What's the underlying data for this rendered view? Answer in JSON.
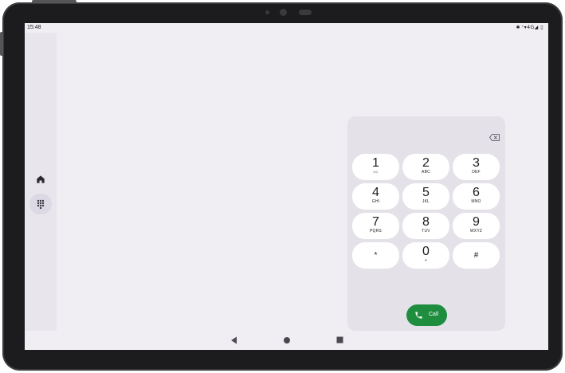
{
  "status_bar": {
    "time": "15:48",
    "indicators": "✱ ᵗ▾4G◢ ▯"
  },
  "nav_rail": {
    "items": [
      {
        "icon": "home-icon"
      },
      {
        "icon": "dialpad-icon",
        "selected": true
      }
    ]
  },
  "dialpad": {
    "keys": [
      {
        "digit": "1",
        "letters": "ဝဝ"
      },
      {
        "digit": "2",
        "letters": "ABC"
      },
      {
        "digit": "3",
        "letters": "DEF"
      },
      {
        "digit": "4",
        "letters": "GHI"
      },
      {
        "digit": "5",
        "letters": "JKL"
      },
      {
        "digit": "6",
        "letters": "MNO"
      },
      {
        "digit": "7",
        "letters": "PQRS"
      },
      {
        "digit": "8",
        "letters": "TUV"
      },
      {
        "digit": "9",
        "letters": "WXYZ"
      },
      {
        "digit": "*",
        "letters": ""
      },
      {
        "digit": "0",
        "letters": "+"
      },
      {
        "digit": "#",
        "letters": ""
      }
    ],
    "call_label": "Call"
  },
  "colors": {
    "call_green": "#1e8e3e",
    "screen_bg": "#f0eef3",
    "key_bg": "#ffffff"
  }
}
